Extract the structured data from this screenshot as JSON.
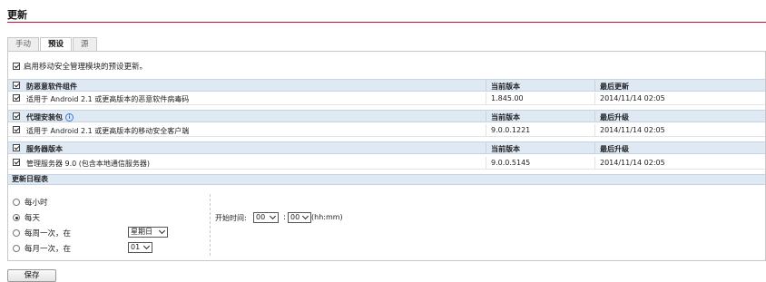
{
  "page": {
    "title": "更新"
  },
  "tabs": [
    {
      "label": "手动",
      "active": false
    },
    {
      "label": "预设",
      "active": true
    },
    {
      "label": "源",
      "active": false
    }
  ],
  "enable": {
    "label": "启用移动安全管理模块的预设更新。",
    "checked": true
  },
  "sections": [
    {
      "header": {
        "name": "防恶意软件组件",
        "col2": "当前版本",
        "col3": "最后更新",
        "has_info_icon": false
      },
      "row": {
        "name": "适用于 Android 2.1 或更高版本的恶意软件病毒码",
        "version": "1.845.00",
        "date": "2014/11/14 02:05"
      }
    },
    {
      "header": {
        "name": "代理安装包",
        "col2": "当前版本",
        "col3": "最后升级",
        "has_info_icon": true,
        "info_glyph": "i"
      },
      "row": {
        "name": "适用于 Android 2.1 或更高版本的移动安全客户端",
        "version": "9.0.0.1221",
        "date": "2014/11/14 02:05"
      }
    },
    {
      "header": {
        "name": "服务器版本",
        "col2": "当前版本",
        "col3": "最后升级",
        "has_info_icon": false
      },
      "row": {
        "name": "管理服务器 9.0 (包含本地通信服务器)",
        "version": "9.0.0.5145",
        "date": "2014/11/14 02:05"
      }
    }
  ],
  "schedule": {
    "title": "更新日程表",
    "options": [
      {
        "label": "每小时",
        "selected": false
      },
      {
        "label": "每天",
        "selected": true
      },
      {
        "label": "每周一次，在",
        "selected": false
      },
      {
        "label": "每月一次，在",
        "selected": false
      }
    ],
    "weekday": "星期日",
    "monthday": "01",
    "start_time": {
      "label": "开始时间:",
      "hour": "00",
      "minute": "00",
      "separator": ":",
      "format": "(hh:mm)"
    }
  },
  "save_label": "保存",
  "colors": {
    "accent_rule": "#c8102e",
    "header_bg": "#dfe9f4"
  }
}
